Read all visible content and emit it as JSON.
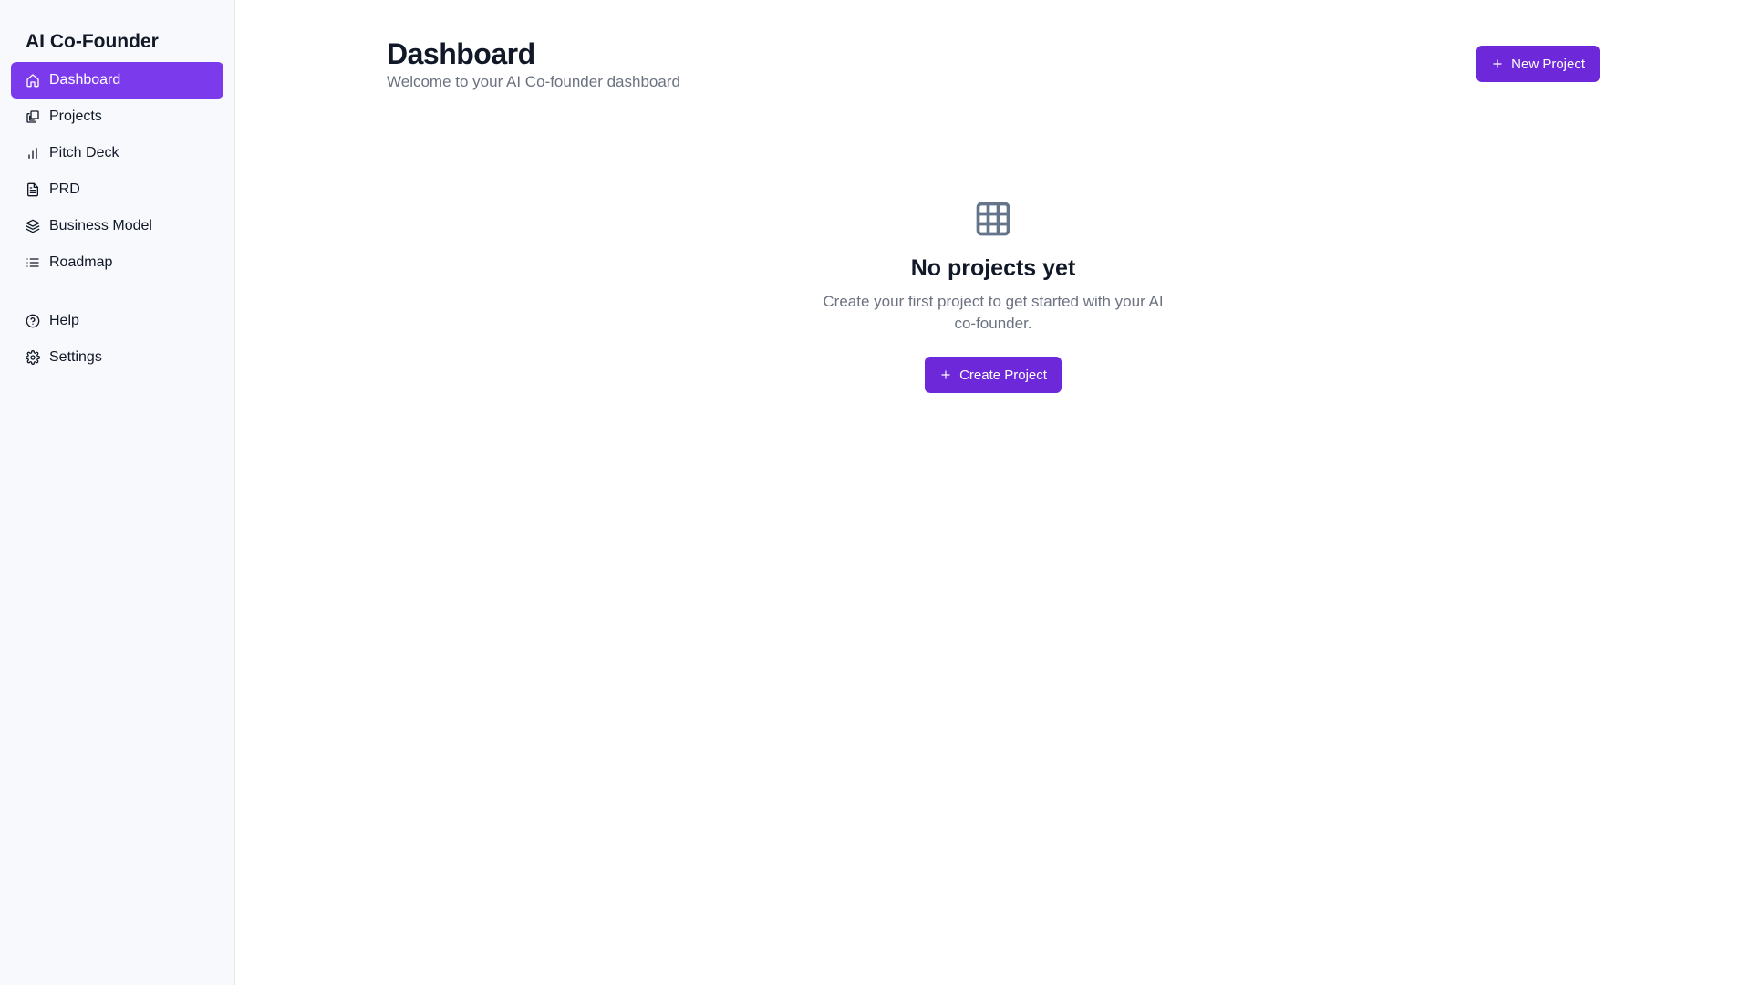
{
  "app": {
    "brand": "AI Co-Founder"
  },
  "sidebar": {
    "items": [
      {
        "label": "Dashboard",
        "icon": "home-icon",
        "active": true
      },
      {
        "label": "Projects",
        "icon": "copy-icon"
      },
      {
        "label": "Pitch Deck",
        "icon": "bar-chart-icon"
      },
      {
        "label": "PRD",
        "icon": "file-text-icon"
      },
      {
        "label": "Business Model",
        "icon": "layers-icon"
      },
      {
        "label": "Roadmap",
        "icon": "list-icon"
      }
    ],
    "secondary": [
      {
        "label": "Help",
        "icon": "help-circle-icon"
      },
      {
        "label": "Settings",
        "icon": "gear-icon"
      }
    ]
  },
  "header": {
    "title": "Dashboard",
    "subtitle": "Welcome to your AI Co-founder dashboard",
    "new_project_label": "New Project"
  },
  "empty_state": {
    "icon": "grid-icon",
    "title": "No projects yet",
    "text": "Create your first project to get started with your AI co-founder.",
    "button_label": "Create Project"
  },
  "colors": {
    "accent": "#6d28d9",
    "active_nav": "#7c3aed",
    "sidebar_bg": "#f8f9fc",
    "muted_text": "#6b7280"
  }
}
